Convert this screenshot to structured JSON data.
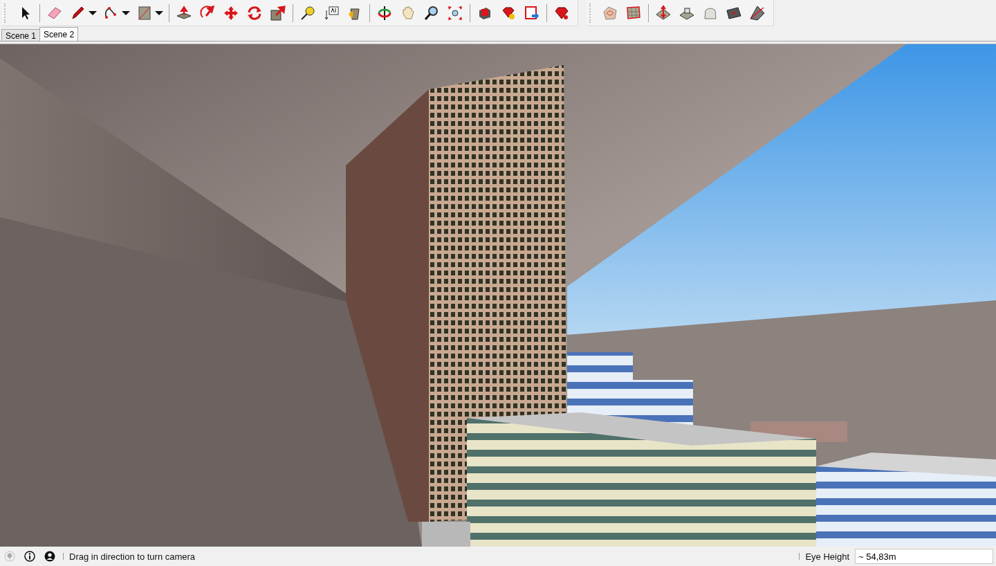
{
  "scene_tabs": [
    {
      "label": "Scene 1",
      "selected": false
    },
    {
      "label": "Scene 2",
      "selected": true
    }
  ],
  "status_bar": {
    "hint": "Drag in direction to turn camera",
    "measurement_label": "Eye Height",
    "measurement_value": "~ 54,83m"
  }
}
